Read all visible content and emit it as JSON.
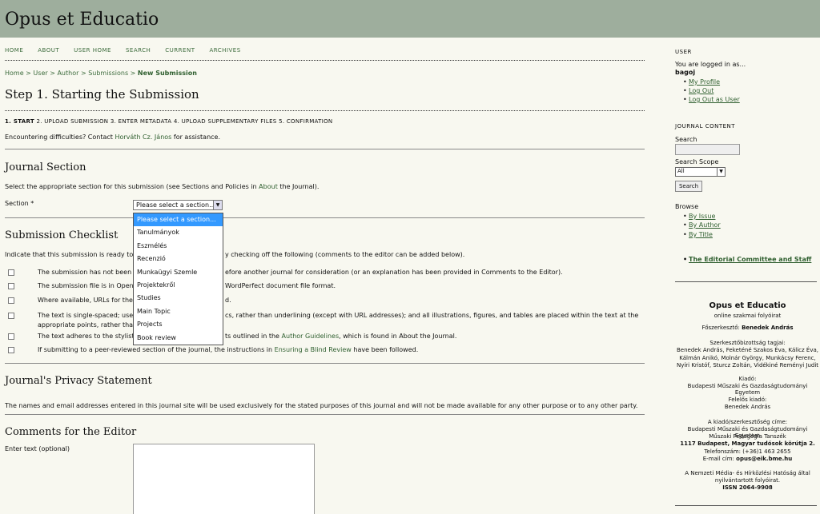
{
  "header": {
    "title": "Opus et Educatio"
  },
  "nav": [
    "HOME",
    "ABOUT",
    "USER HOME",
    "SEARCH",
    "CURRENT",
    "ARCHIVES"
  ],
  "breadcrumb": {
    "home": "Home",
    "sep": ">",
    "user": "User",
    "author": "Author",
    "submissions": "Submissions",
    "current": "New Submission"
  },
  "page_title": "Step 1. Starting the Submission",
  "steps": {
    "step1": "1. START",
    "rest": "2. UPLOAD SUBMISSION   3. ENTER METADATA   4. UPLOAD SUPPLEMENTARY FILES   5. CONFIRMATION"
  },
  "difficulties": {
    "prefix": "Encountering difficulties? Contact",
    "contact": "Horváth Cz. János",
    "suffix": "for assistance."
  },
  "journal_section": {
    "heading": "Journal Section",
    "text_prefix": "Select the appropriate section for this submission (see Sections and Policies in",
    "about_link": "About",
    "text_suffix": "the Journal).",
    "label": "Section *",
    "selected": "Please select a section...",
    "options": [
      "Please select a section...",
      "Tanulmányok",
      "Eszmélés",
      "Recenzió",
      "Munkaügyi Szemle",
      "Projektekről",
      "Studies",
      "Main Topic",
      "Projects",
      "Book review"
    ]
  },
  "checklist": {
    "heading": "Submission Checklist",
    "intro_a": "Indicate that this submission is ready to be",
    "intro_b": "y checking off the following (comments to the editor can be added below).",
    "items": [
      {
        "a": "The submission has not been p",
        "b": "efore another journal for consideration (or an explanation has been provided in Comments to the Editor)."
      },
      {
        "a": "The submission file is in OpenO",
        "b": "WordPerfect document file format."
      },
      {
        "a": "Where available, URLs for the r",
        "b": "d."
      },
      {
        "a": "The text is single-spaced; uses",
        "b": "cs, rather than underlining (except with URL addresses); and all illustrations, figures, and tables are placed within the text at the"
      },
      {
        "a": "appropriate points, rather than",
        "b": ""
      },
      {
        "a": "The text adheres to the stylistic",
        "b": "ts outlined in the",
        "link": "Author Guidelines",
        "c": ", which is found in About the Journal."
      },
      {
        "a": "If submitting to a peer-reviewed section of the journal, the instructions in",
        "link": "Ensuring a Blind Review",
        "c": "have been followed."
      }
    ]
  },
  "privacy": {
    "heading": "Journal's Privacy Statement",
    "text": "The names and email addresses entered in this journal site will be used exclusively for the stated purposes of this journal and will not be made available for any other purpose or to any other party."
  },
  "comments": {
    "heading": "Comments for the Editor",
    "label": "Enter text (optional)"
  },
  "sidebar": {
    "user_heading": "USER",
    "logged_in": "You are logged in as...",
    "username": "bagoj",
    "user_links": [
      "My Profile",
      "Log Out",
      "Log Out as User"
    ],
    "content_heading": "JOURNAL CONTENT",
    "search_label": "Search",
    "scope_label": "Search Scope",
    "scope_value": "All",
    "search_button": "Search",
    "browse_label": "Browse",
    "browse_links": [
      "By Issue",
      "By Author",
      "By Title"
    ],
    "committee_link": "The Editorial Committee and Staff",
    "info": {
      "title": "Opus et Educatio",
      "subtitle": "online szakmai folyóirat",
      "editor_label": "Főszerkesztő:",
      "editor": "Benedek András",
      "board_label": "Szerkesztőbizottság tagjai:",
      "board_1": "Benedek András, Feketéné Szakos Éva, Kálicz Éva,",
      "board_2": "Kálmán Anikó, Molnár György, Munkácsy Ferenc,",
      "board_3": "Nyíri Kristóf, Sturcz Zoltán, Vidékiné Reményi Judit",
      "publisher_label": "Kiadó:",
      "publisher": "Budapesti Műszaki és Gazdaságtudományi Egyetem",
      "responsible_label": "Felelős kiadó:",
      "responsible": "Benedek András",
      "address_label": "A kiadó/szerkesztőség címe:",
      "address_1": "Budapesti Műszaki és Gazdaságtudományi Egyetem",
      "address_2": "Műszaki Pedagógia Tanszék",
      "address_3": "1117 Budapest, Magyar tudósok körútja 2.",
      "phone": "Telefonszám: (+36)1 463 2655",
      "email_label": "E-mail cím:",
      "email": "opus@eik.bme.hu",
      "registry_1": "A Nemzeti Média- és Hírközlési Hatóság által",
      "registry_2": "nyilvántartott folyóirat.",
      "issn": "ISSN 2064-9908"
    }
  }
}
